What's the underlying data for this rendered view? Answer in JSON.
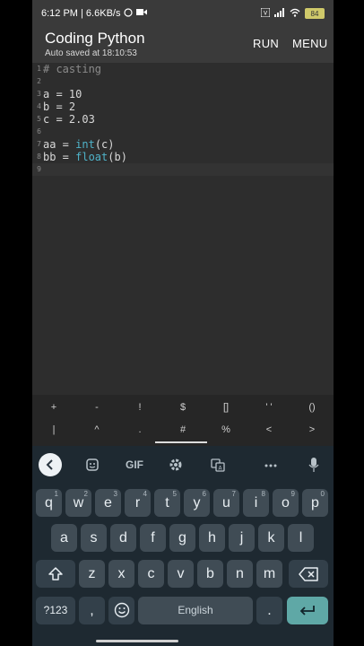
{
  "status_bar": {
    "time_speed": "6:12 PM | 6.6KB/s",
    "icons": [
      "whatsapp-icon",
      "video-icon",
      "volte-icon",
      "signal-4g-icon",
      "wifi-icon"
    ],
    "battery": "84"
  },
  "app": {
    "title": "Coding Python",
    "subtitle": "Auto saved at 18:10:53",
    "run_label": "RUN",
    "menu_label": "MENU"
  },
  "editor": {
    "line_numbers": [
      "1",
      "2",
      "3",
      "4",
      "5",
      "6",
      "7",
      "8",
      "9"
    ],
    "lines": [
      {
        "text": "# casting",
        "kind": "comment"
      },
      {
        "text": "",
        "kind": "plain"
      },
      {
        "text": "a = 10",
        "kind": "plain"
      },
      {
        "text": "b = 2",
        "kind": "plain"
      },
      {
        "text": "c = 2.03",
        "kind": "plain"
      },
      {
        "text": "",
        "kind": "plain"
      },
      {
        "pre": "aa = ",
        "fn": "int",
        "post": "(c)",
        "kind": "call"
      },
      {
        "pre": "bb = ",
        "fn": "float",
        "post": "(b)",
        "kind": "call"
      },
      {
        "text": "",
        "kind": "plain"
      }
    ]
  },
  "symbols": {
    "row1": [
      "+",
      "-",
      "!",
      "$",
      "[]",
      "' '",
      "()"
    ],
    "row2": [
      "|",
      "^",
      ".",
      "#",
      "%",
      "<",
      ">"
    ]
  },
  "keyboard": {
    "toolbar": {
      "gif_label": "GIF",
      "icons": [
        "back-chevron-icon",
        "sticker-icon",
        "gif-icon",
        "settings-gear-icon",
        "translate-icon",
        "more-icon",
        "mic-icon"
      ]
    },
    "row1": [
      {
        "k": "q",
        "s": "1"
      },
      {
        "k": "w",
        "s": "2"
      },
      {
        "k": "e",
        "s": "3"
      },
      {
        "k": "r",
        "s": "4"
      },
      {
        "k": "t",
        "s": "5"
      },
      {
        "k": "y",
        "s": "6"
      },
      {
        "k": "u",
        "s": "7"
      },
      {
        "k": "i",
        "s": "8"
      },
      {
        "k": "o",
        "s": "9"
      },
      {
        "k": "p",
        "s": "0"
      }
    ],
    "row2": [
      "a",
      "s",
      "d",
      "f",
      "g",
      "h",
      "j",
      "k",
      "l"
    ],
    "row3": [
      "z",
      "x",
      "c",
      "v",
      "b",
      "n",
      "m"
    ],
    "bottom": {
      "sym_label": "?123",
      "comma": ",",
      "emoji_icon": "emoji-icon",
      "space_label": "English",
      "period": ".",
      "enter_icon": "enter-icon"
    }
  }
}
